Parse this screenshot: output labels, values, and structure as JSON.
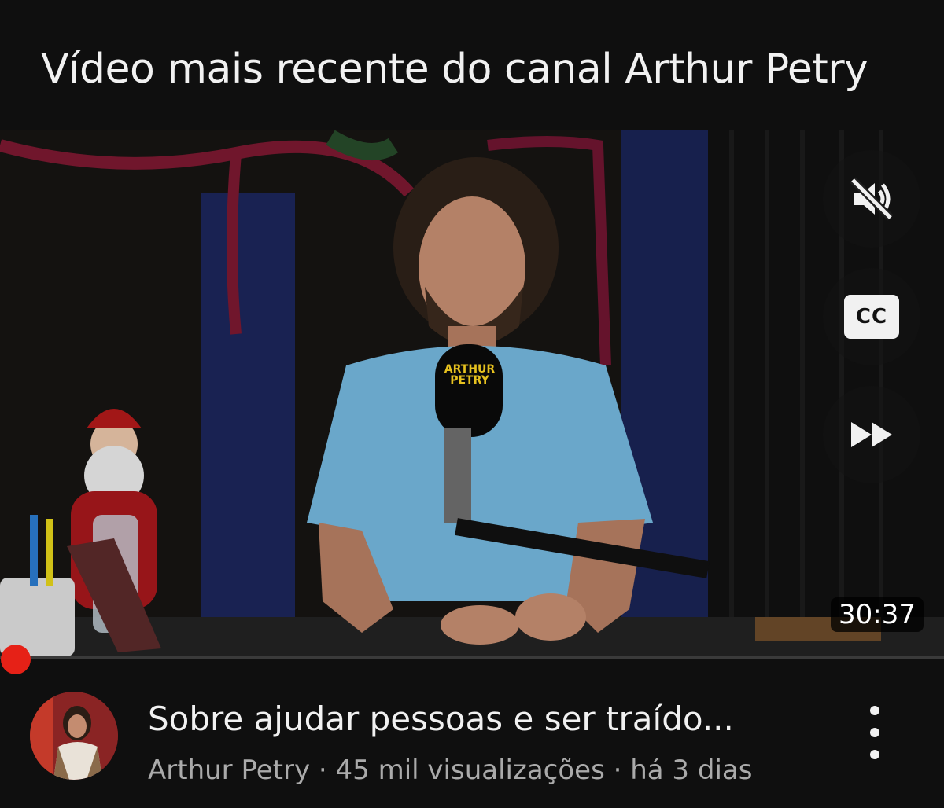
{
  "header": {
    "title": "Vídeo mais recente do canal Arthur Petry"
  },
  "player": {
    "controls": [
      {
        "name": "mute-button",
        "icon": "volume-muted-icon"
      },
      {
        "name": "captions-button",
        "icon": "closed-captions-icon",
        "label": "CC"
      },
      {
        "name": "fast-forward-button",
        "icon": "fast-forward-icon"
      }
    ],
    "duration": "30:37",
    "progress": 0.0,
    "microphone_logo": "ARTHUR PETRY",
    "accent_color": "#e62117"
  },
  "video": {
    "title": "Sobre ajudar pessoas e ser traído...",
    "channel": "Arthur Petry",
    "views": "45 mil visualizações",
    "age": "há 3 dias",
    "separator": "·",
    "more_icon": "more-vertical-icon"
  }
}
